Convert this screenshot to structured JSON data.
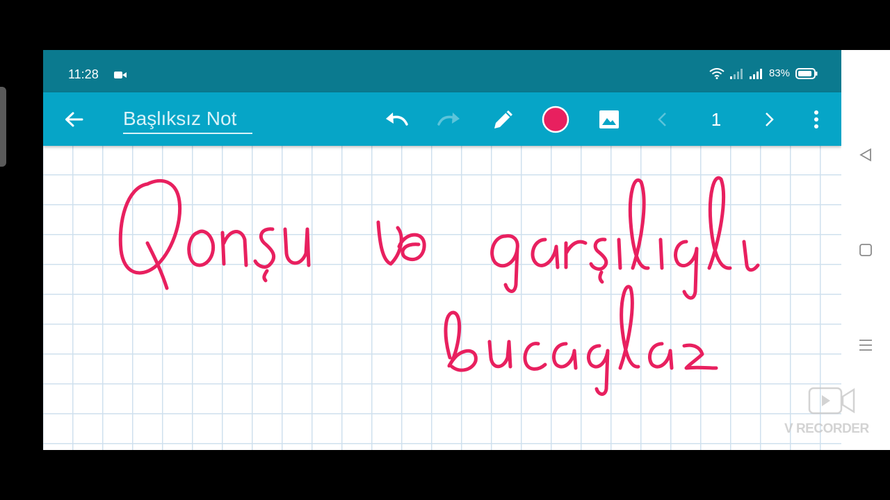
{
  "status_bar": {
    "time": "11:28",
    "battery_percent": "83%",
    "icons": [
      "video-camera-icon",
      "wifi-icon",
      "signal-icon",
      "battery-icon"
    ]
  },
  "toolbar": {
    "title": "Başlıksız Not",
    "page_number": "1",
    "icons": [
      "back-arrow-icon",
      "undo-icon",
      "redo-icon",
      "pencil-icon",
      "color-swatch",
      "image-icon",
      "chevron-left-icon",
      "chevron-right-icon",
      "more-vert-icon"
    ],
    "pen_color": "#e8205f",
    "bar_color": "#06a5c7",
    "status_color": "#0b7a8f"
  },
  "canvas": {
    "handwriting": "Qonşu və qarşılıqlı bucaqlar",
    "ink_color": "#e8205f",
    "grid_color": "#cfe0ee"
  },
  "nav_bar": {
    "icons": [
      "back-triangle-icon",
      "home-square-icon",
      "recents-menu-icon"
    ]
  },
  "watermark": {
    "text": "V RECORDER",
    "icon": "video-recorder-icon"
  }
}
